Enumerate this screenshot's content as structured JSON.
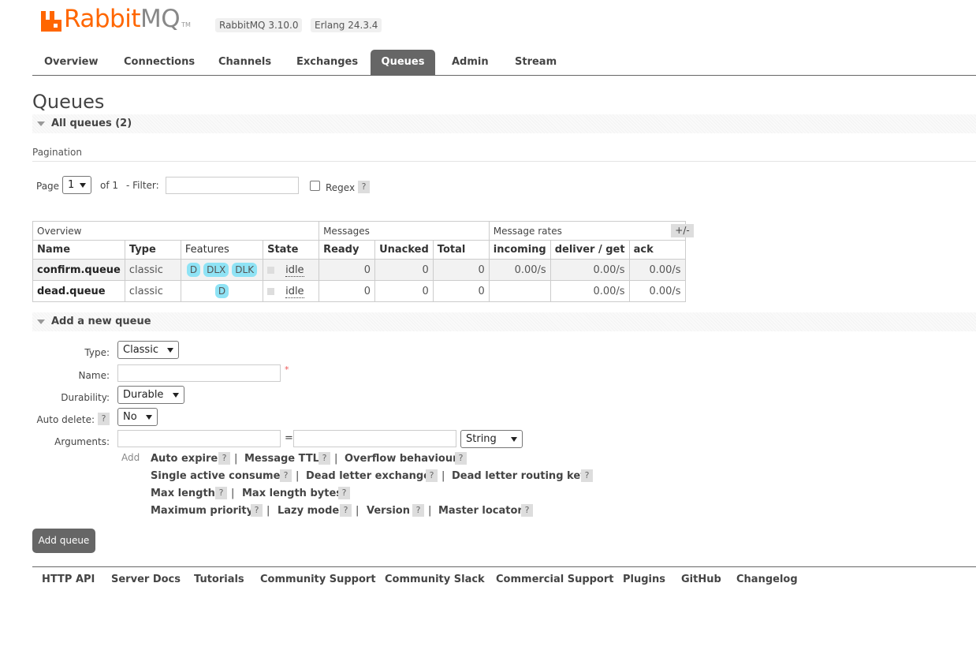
{
  "header": {
    "logo_word_a": "Rabbit",
    "logo_word_b": "MQ",
    "logo_tm": "TM",
    "version_rabbitmq": "RabbitMQ 3.10.0",
    "version_erlang": "Erlang 24.3.4",
    "brand_color": "#ff6600"
  },
  "tabs": [
    {
      "label": "Overview"
    },
    {
      "label": "Connections"
    },
    {
      "label": "Channels"
    },
    {
      "label": "Exchanges"
    },
    {
      "label": "Queues",
      "active": true
    },
    {
      "label": "Admin"
    },
    {
      "label": "Stream"
    }
  ],
  "page_title": "Queues",
  "all_queues_section": "All queues (2)",
  "pagination": {
    "heading": "Pagination",
    "page_label": "Page",
    "page_value": "1",
    "of_label": "of 1",
    "filter_label": "- Filter:",
    "filter_value": "",
    "regex_label": "Regex",
    "help": "?"
  },
  "table": {
    "groups": [
      "Overview",
      "Messages",
      "Message rates"
    ],
    "columns": [
      "Name",
      "Type",
      "Features",
      "State",
      "Ready",
      "Unacked",
      "Total",
      "incoming",
      "deliver / get",
      "ack"
    ],
    "toggle_columns": "+/-",
    "rows": [
      {
        "name": "confirm.queue",
        "type": "classic",
        "features": [
          "D",
          "DLX",
          "DLK"
        ],
        "state": "idle",
        "ready": "0",
        "unacked": "0",
        "total": "0",
        "incoming": "0.00/s",
        "deliver_get": "0.00/s",
        "ack": "0.00/s"
      },
      {
        "name": "dead.queue",
        "type": "classic",
        "features": [
          "D"
        ],
        "state": "idle",
        "ready": "0",
        "unacked": "0",
        "total": "0",
        "incoming": "",
        "deliver_get": "0.00/s",
        "ack": "0.00/s"
      }
    ]
  },
  "add_queue_section": "Add a new queue",
  "form": {
    "type_label": "Type:",
    "type_value": "Classic",
    "name_label": "Name:",
    "name_value": "",
    "required_mark": "*",
    "durability_label": "Durability:",
    "durability_value": "Durable",
    "auto_delete_label": "Auto delete:",
    "auto_delete_value": "No",
    "arguments_label": "Arguments:",
    "equals": "=",
    "arg_type_value": "String",
    "add_label": "Add",
    "options": [
      [
        "Auto expire",
        "Message TTL",
        "Overflow behaviour"
      ],
      [
        "Single active consumer",
        "Dead letter exchange",
        "Dead letter routing key"
      ],
      [
        "Max length",
        "Max length bytes"
      ],
      [
        "Maximum priority",
        "Lazy mode",
        "Version",
        "Master locator"
      ]
    ],
    "separator": "|",
    "submit_label": "Add queue"
  },
  "footer_links": [
    "HTTP API",
    "Server Docs",
    "Tutorials",
    "Community Support",
    "Community Slack",
    "Commercial Support",
    "Plugins",
    "GitHub",
    "Changelog"
  ]
}
